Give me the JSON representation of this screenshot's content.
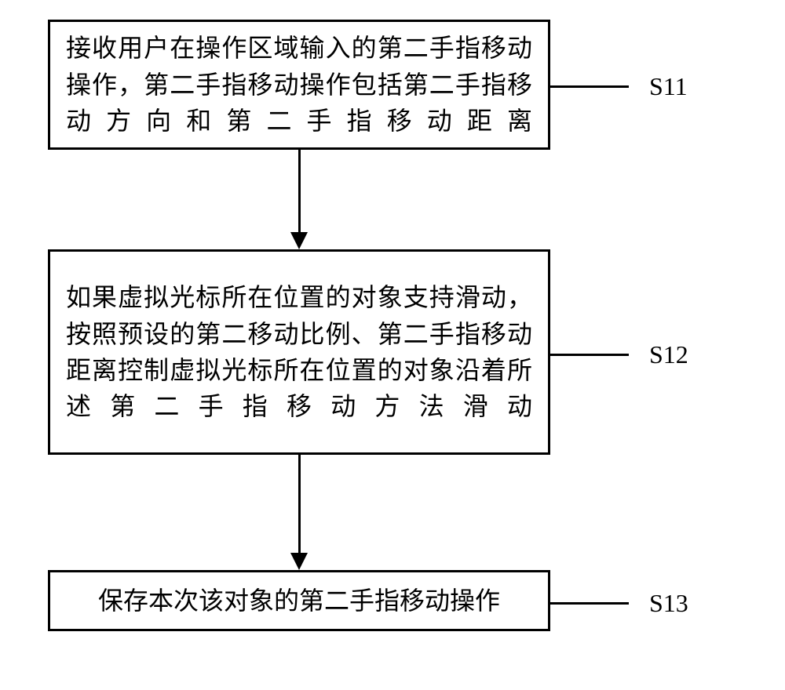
{
  "chart_data": {
    "type": "flowchart",
    "nodes": [
      {
        "id": "S11",
        "text": "接收用户在操作区域输入的第二手指移动操作，第二手指移动操作包括第二手指移动方向和第二手指移动距离"
      },
      {
        "id": "S12",
        "text": "如果虚拟光标所在位置的对象支持滑动，按照预设的第二移动比例、第二手指移动距离控制虚拟光标所在位置的对象沿着所述第二手指移动方法滑动"
      },
      {
        "id": "S13",
        "text": "保存本次该对象的第二手指移动操作"
      }
    ],
    "edges": [
      {
        "from": "S11",
        "to": "S12"
      },
      {
        "from": "S12",
        "to": "S13"
      }
    ]
  },
  "labels": {
    "s11": "S11",
    "s12": "S12",
    "s13": "S13"
  }
}
